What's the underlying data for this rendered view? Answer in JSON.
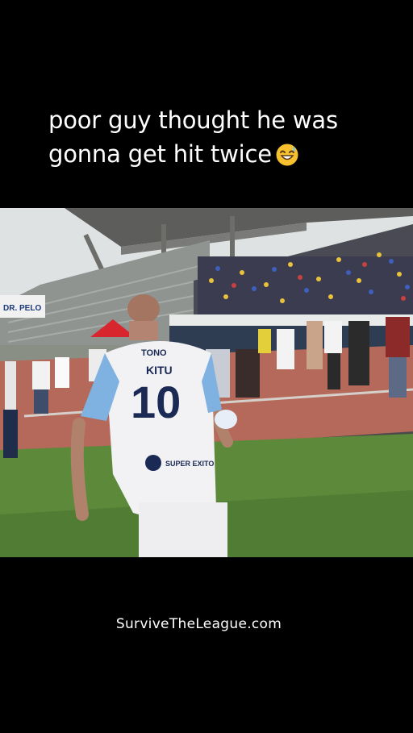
{
  "caption": {
    "line1": "poor guy thought he was",
    "line2": "gonna get hit twice",
    "emoji": "grinning-sweat-emoji"
  },
  "video": {
    "jersey_name": "KITU",
    "jersey_number": "10",
    "jersey_sponsor": "SUPER EXITO",
    "jersey_top_sponsor": "TONO",
    "banner": "DR. PELO"
  },
  "watermark": "SurviveTheLeague.com",
  "colors": {
    "background": "#000000",
    "grass": "#5c8a3a",
    "track": "#b5695a",
    "jersey": "#f2f2f4",
    "jersey_sleeve": "#7fb2e0"
  }
}
